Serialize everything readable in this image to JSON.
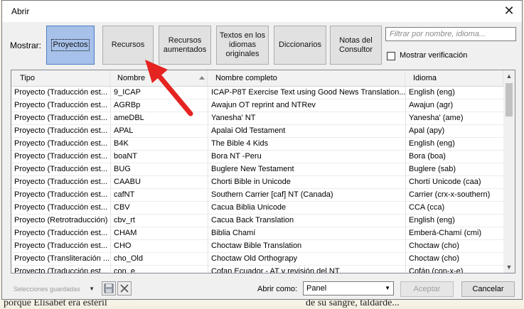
{
  "dialog": {
    "title": "Abrir"
  },
  "toolbar": {
    "show_label": "Mostrar:",
    "buttons": [
      {
        "label": "Proyectos",
        "active": true
      },
      {
        "label": "Recursos",
        "active": false
      },
      {
        "label": "Recursos aumentados",
        "active": false
      },
      {
        "label": "Textos en los idiomas originales",
        "active": false
      },
      {
        "label": "Diccionarios",
        "active": false
      },
      {
        "label": "Notas del Consultor",
        "active": false
      }
    ],
    "filter_placeholder": "Filtrar por nombre, idioma...",
    "show_verification_label": "Mostrar verificación",
    "show_verification_checked": false
  },
  "table": {
    "columns": [
      "Tipo",
      "Nombre",
      "Nombre completo",
      "Idioma"
    ],
    "sorted_column": "Nombre",
    "rows": [
      [
        "Proyecto (Traducción est...",
        "9_ICAP",
        "ICAP-P8T Exercise Text using Good News Translation...",
        "English (eng)"
      ],
      [
        "Proyecto (Traducción est...",
        "AGRBp",
        "Awajun OT reprint and NTRev",
        "Awajun (agr)"
      ],
      [
        "Proyecto (Traducción est...",
        "ameDBL",
        "Yanesha' NT",
        "Yanesha' (ame)"
      ],
      [
        "Proyecto (Traducción est...",
        "APAL",
        "Apalai Old Testament",
        "Apal (apy)"
      ],
      [
        "Proyecto (Traducción est...",
        "B4K",
        "The Bible 4 Kids",
        "English (eng)"
      ],
      [
        "Proyecto (Traducción est...",
        "boaNT",
        "Bora NT -Peru",
        "Bora (boa)"
      ],
      [
        "Proyecto (Traducción est...",
        "BUG",
        "Buglere New Testament",
        "Buglere (sab)"
      ],
      [
        "Proyecto (Traducción est...",
        "CAABU",
        "Chorti Bible in Unicode",
        "Chortí Unicode (caa)"
      ],
      [
        "Proyecto (Traducción est...",
        "cafNT",
        "Southern Carrier [caf] NT (Canada)",
        "Carrier (crx-x-southern)"
      ],
      [
        "Proyecto (Traducción est...",
        "CBV",
        "Cacua Biblia Unicode",
        "CCA (cca)"
      ],
      [
        "Proyecto (Retrotraducción)",
        "cbv_rt",
        "Cacua Back Translation",
        "English (eng)"
      ],
      [
        "Proyecto (Traducción est...",
        "CHAM",
        "Biblia Chamí",
        "Emberá-Chamí (cmi)"
      ],
      [
        "Proyecto (Traducción est...",
        "CHO",
        "Choctaw Bible Translation",
        "Choctaw (cho)"
      ],
      [
        "Proyecto (Transliteración ...",
        "cho_Old",
        "Choctaw Old Orthograpy",
        "Choctaw (cho)"
      ],
      [
        "Proyecto (Traducción est...",
        "con_e",
        "Cofan Ecuador - AT y revisión del NT",
        "Cofán (con-x-e)"
      ]
    ]
  },
  "footer": {
    "saved_selections": "Selecciones guardadas",
    "open_as_label": "Abrir como:",
    "open_as_value": "Panel",
    "accept_label": "Aceptar",
    "cancel_label": "Cancelar"
  },
  "background_text": {
    "bottom_left": "porque Elisabet era estéril",
    "bottom_right": "de su sangre, taldarde..."
  },
  "colors": {
    "active_tab": "#a7c1ea",
    "annotation_arrow": "#e52421"
  }
}
